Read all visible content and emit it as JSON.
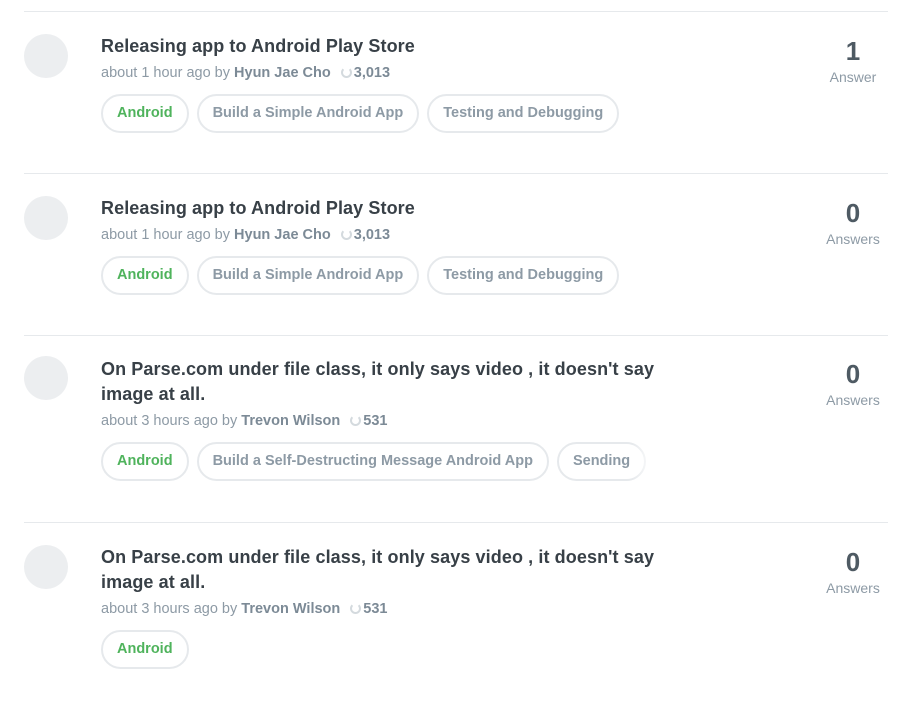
{
  "questions": [
    {
      "title": "Releasing app to Android Play Store",
      "time": "about 1 hour ago by",
      "author": "Hyun Jae Cho",
      "points": "3,013",
      "tags": [
        "Android",
        "Build a Simple Android App",
        "Testing and Debugging"
      ],
      "answer_count": "1",
      "answer_label": "Answer"
    },
    {
      "title": "Releasing app to Android Play Store",
      "time": "about 1 hour ago by",
      "author": "Hyun Jae Cho",
      "points": "3,013",
      "tags": [
        "Android",
        "Build a Simple Android App",
        "Testing and Debugging"
      ],
      "answer_count": "0",
      "answer_label": "Answers"
    },
    {
      "title": "On Parse.com under file class, it only says video , it doesn't say image at all.",
      "time": "about 3 hours ago by",
      "author": "Trevon Wilson",
      "points": "531",
      "tags": [
        "Android",
        "Build a Self-Destructing Message Android App",
        "Sending"
      ],
      "answer_count": "0",
      "answer_label": "Answers"
    },
    {
      "title": "On Parse.com under file class, it only says video , it doesn't say image at all.",
      "time": "about 3 hours ago by",
      "author": "Trevon Wilson",
      "points": "531",
      "tags": [
        "Android"
      ],
      "answer_count": "0",
      "answer_label": "Answers"
    }
  ],
  "colors": {
    "tag_primary": "#4fb35c",
    "text_dark": "#384047",
    "text_muted": "#8d9aa5",
    "divider": "#e6e9ec"
  },
  "icons": {
    "points": "points-icon"
  }
}
